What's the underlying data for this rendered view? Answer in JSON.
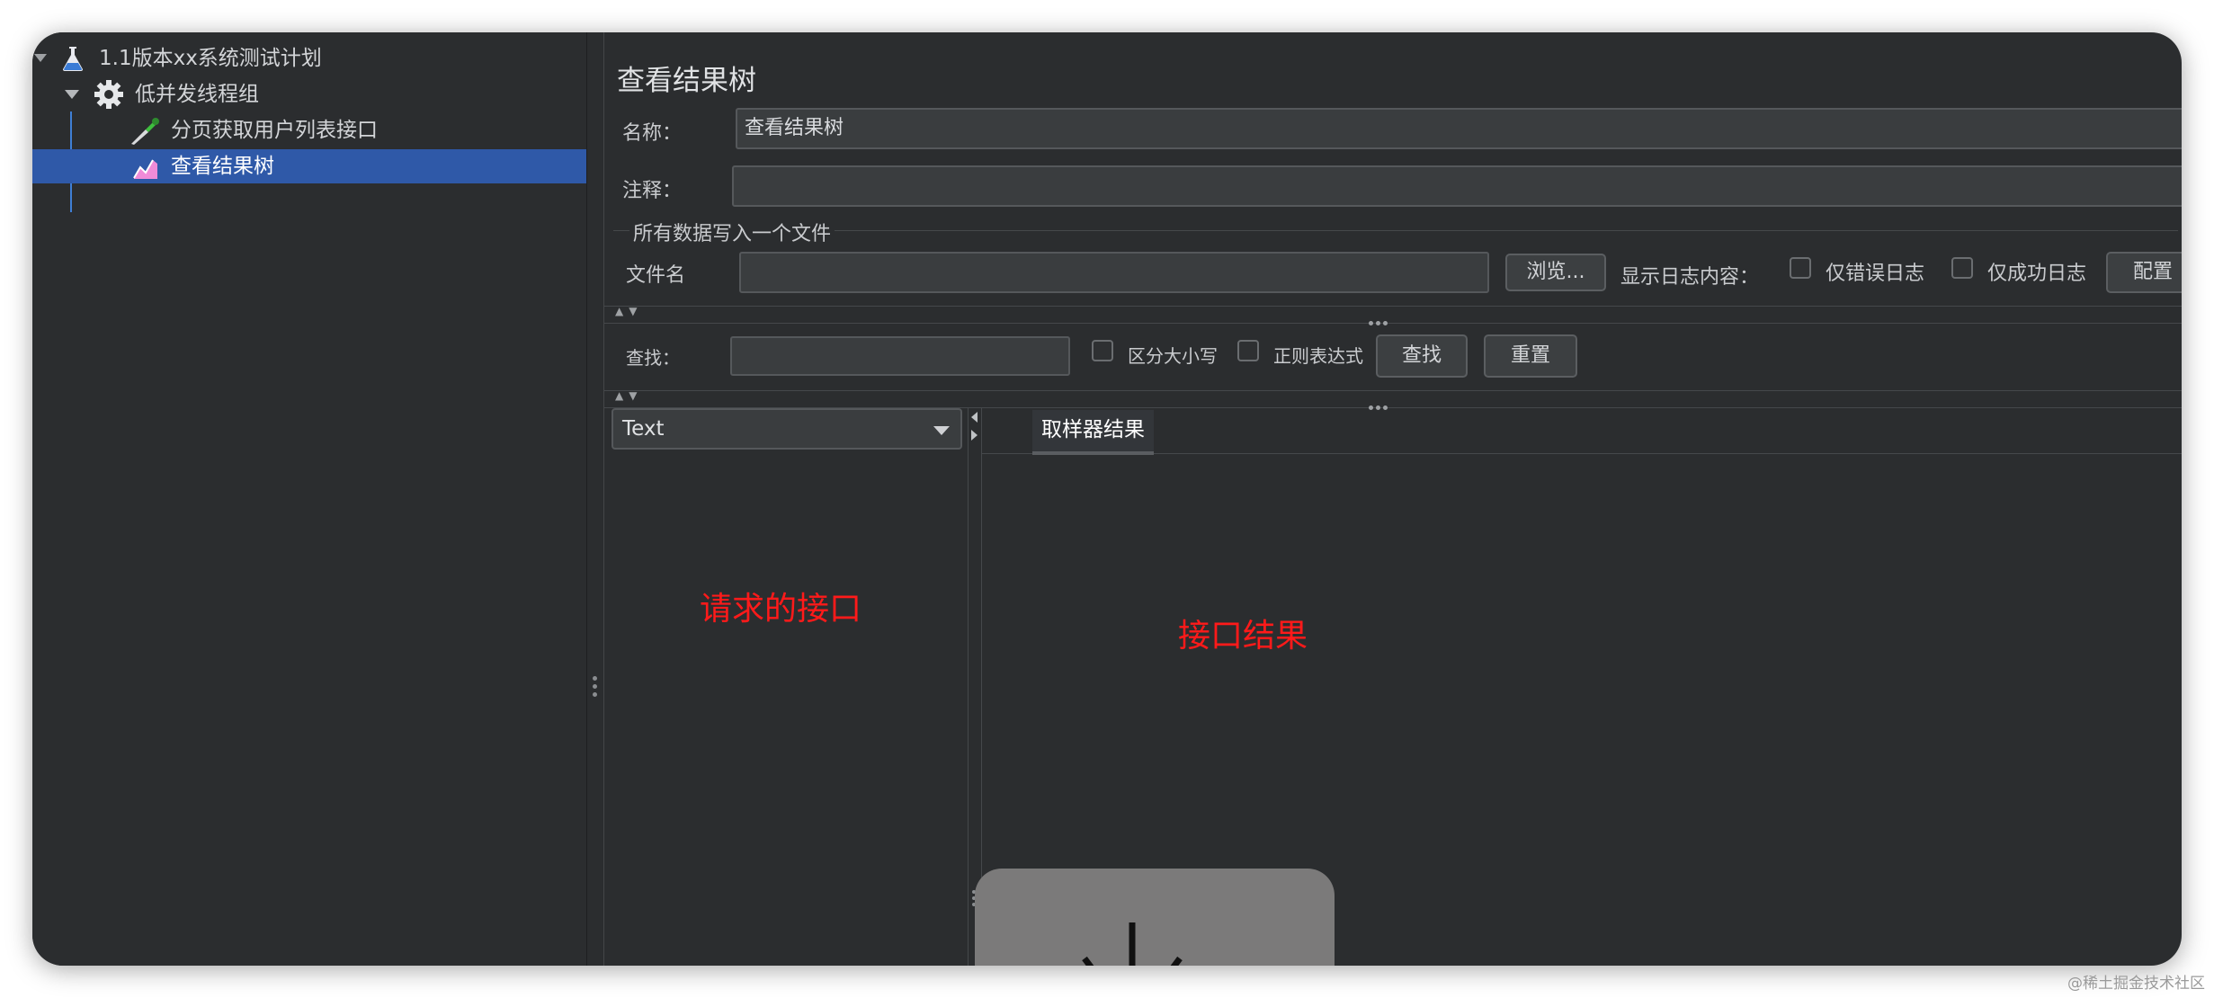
{
  "tree": {
    "plan": "1.1版本xx系统测试计划",
    "thread_group": "低并发线程组",
    "sampler": "分页获取用户列表接口",
    "listener": "查看结果树"
  },
  "panel": {
    "title": "查看结果树",
    "name_label": "名称：",
    "name_value": "查看结果树",
    "comment_label": "注释：",
    "comment_value": "",
    "file_section": "所有数据写入一个文件",
    "filename_label": "文件名",
    "filename_value": "",
    "browse_button": "浏览...",
    "log_label": "显示日志内容：",
    "errors_only": "仅错误日志",
    "success_only": "仅成功日志",
    "configure_button": "配置",
    "search_label": "查找：",
    "search_value": "",
    "case_sensitive": "区分大小写",
    "regex": "正则表达式",
    "find_button": "查找",
    "reset_button": "重置",
    "renderer_select": "Text",
    "result_tab": "取样器结果"
  },
  "annotations": {
    "left": "请求的接口",
    "right": "接口结果"
  },
  "watermark": "@稀土掘金技术社区"
}
